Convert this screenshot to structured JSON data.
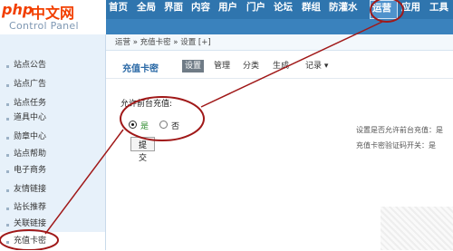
{
  "logo": {
    "php": "php",
    "cn": "中文网",
    "subtitle": "Control Panel"
  },
  "topnav": {
    "items": [
      {
        "label": "首页"
      },
      {
        "label": "全局"
      },
      {
        "label": "界面"
      },
      {
        "label": "内容"
      },
      {
        "label": "用户"
      },
      {
        "label": "门户"
      },
      {
        "label": "论坛"
      },
      {
        "label": "群组"
      },
      {
        "label": "防灌水"
      },
      {
        "label": "运营",
        "active": true
      },
      {
        "label": "应用"
      },
      {
        "label": "工具"
      }
    ]
  },
  "sidebar": {
    "items": [
      {
        "label": "站点公告"
      },
      {
        "label": "站点广告"
      },
      {
        "label": "站点任务"
      },
      {
        "label": "道具中心"
      },
      {
        "label": "勋章中心"
      },
      {
        "label": "站点帮助"
      },
      {
        "label": "电子商务"
      },
      {
        "label": "友情链接"
      },
      {
        "label": "站长推荐"
      },
      {
        "label": "关联链接"
      },
      {
        "label": "充值卡密",
        "active": true
      }
    ]
  },
  "breadcrumb": "运营 » 充值卡密 » 设置 [+]",
  "page": {
    "title": "充值卡密",
    "tabs": [
      {
        "label": "设置",
        "active": true
      },
      {
        "label": "管理"
      },
      {
        "label": "分类"
      },
      {
        "label": "生成"
      },
      {
        "label": "记录 ▾"
      }
    ]
  },
  "form": {
    "label": "允许前台充值:",
    "options": [
      {
        "label": "是",
        "checked": true
      },
      {
        "label": "否",
        "checked": false
      }
    ],
    "help_line1": "设置是否允许前台充值：是",
    "help_line2": "充值卡密验证码开关：是",
    "submit_label": "提交"
  },
  "annotation": {
    "color": "#a01818"
  }
}
